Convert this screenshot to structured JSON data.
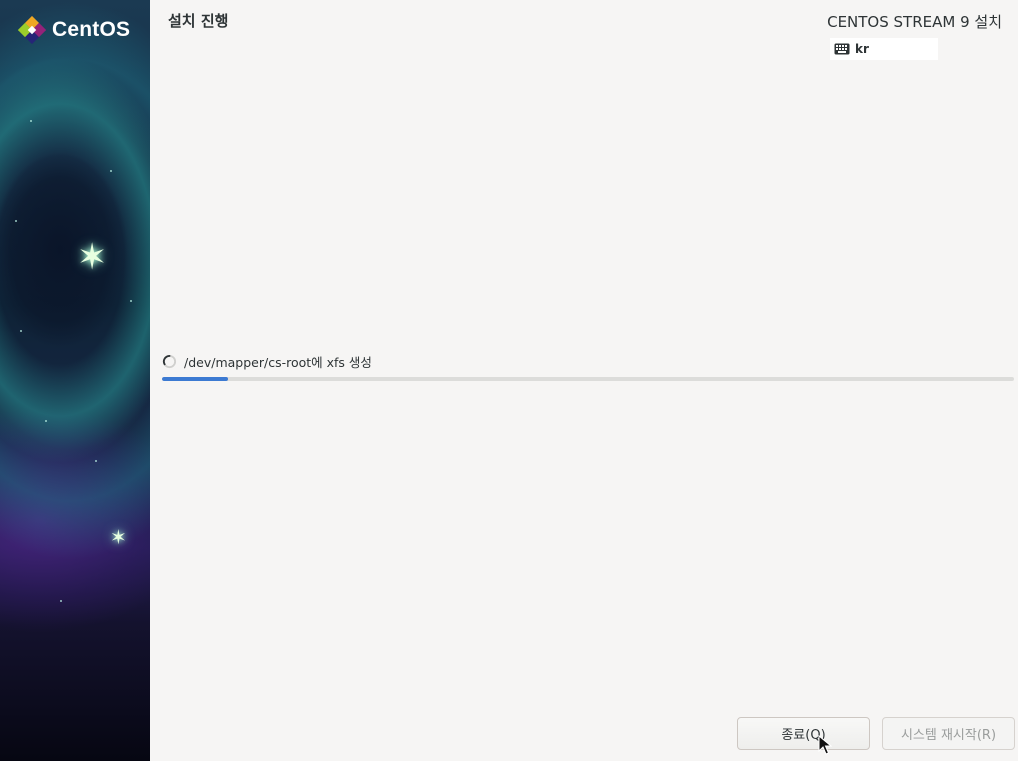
{
  "sidebar": {
    "brand": "CentOS"
  },
  "header": {
    "page_title": "설치 진행",
    "product_title": "CENTOS STREAM 9 설치",
    "keyboard_layout": "kr"
  },
  "progress": {
    "status_text": "/dev/mapper/cs-root에 xfs 생성",
    "fraction": 0.078
  },
  "buttons": {
    "quit_label": "종료(Q)",
    "reboot_label": "시스템 재시작(R)",
    "reboot_enabled": false
  },
  "icons": {
    "logo": "centos-logo-icon",
    "keyboard": "keyboard-icon",
    "spinner": "spinner-icon",
    "cursor": "mouse-pointer-icon"
  },
  "colors": {
    "accent": "#3c7ad2",
    "background": "#f6f5f4",
    "text": "#2e3436"
  }
}
